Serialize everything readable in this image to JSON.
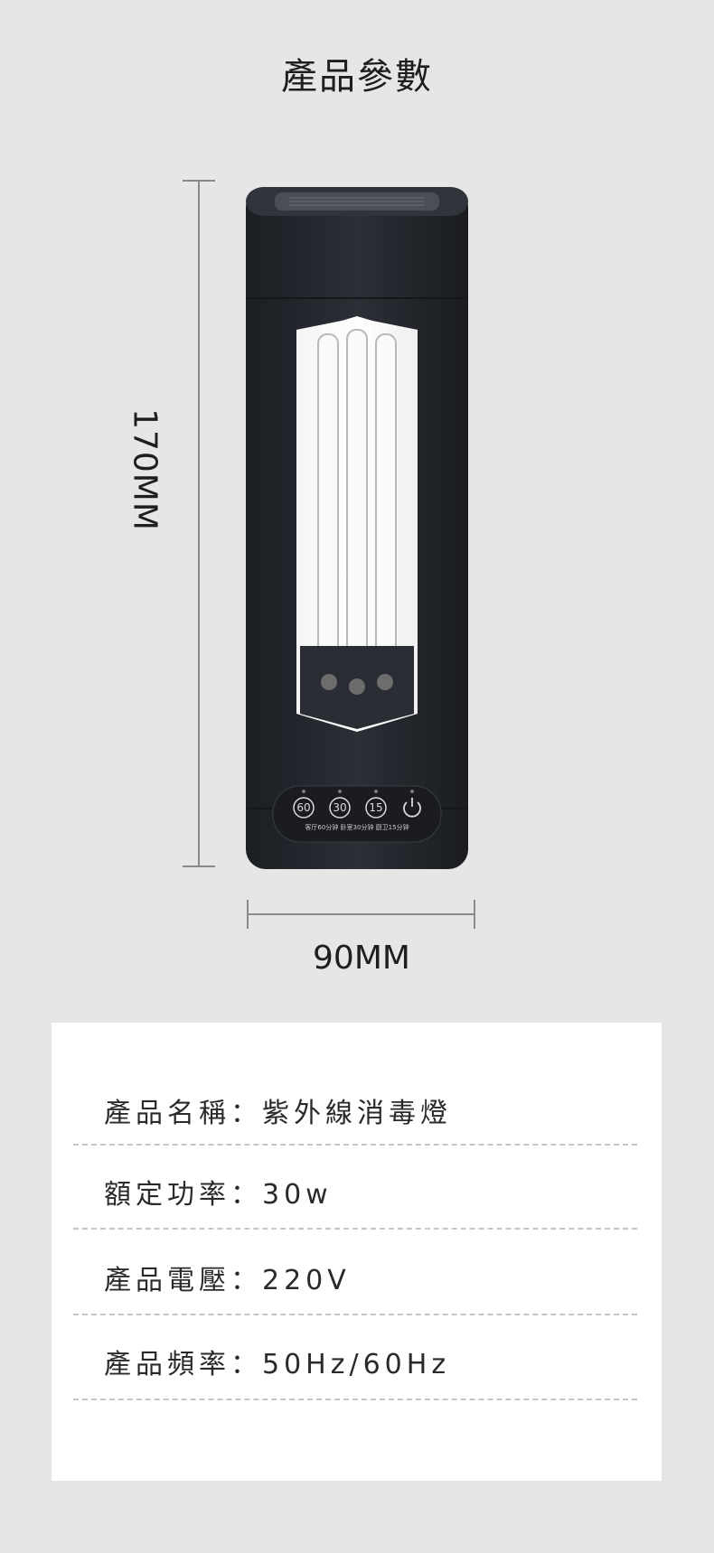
{
  "page": {
    "title": "產品參數",
    "height_label": "170MM",
    "width_label": "90MM"
  },
  "product": {
    "buttons": [
      "60",
      "30",
      "15"
    ],
    "power_icon": "power-icon",
    "panel_caption": "客厅60分钟 卧室30分钟 厨卫15分钟"
  },
  "specs": [
    {
      "label": "產品名稱",
      "sep": "：",
      "value": "紫外線消毒燈"
    },
    {
      "label": "額定功率",
      "sep": "：",
      "value": "30w"
    },
    {
      "label": "產品電壓",
      "sep": "：",
      "value": "220V"
    },
    {
      "label": "產品頻率",
      "sep": "：",
      "value": "50Hz/60Hz"
    }
  ],
  "colors": {
    "background": "#e6e6e6",
    "card": "#ffffff",
    "device_body": "#22252b"
  }
}
